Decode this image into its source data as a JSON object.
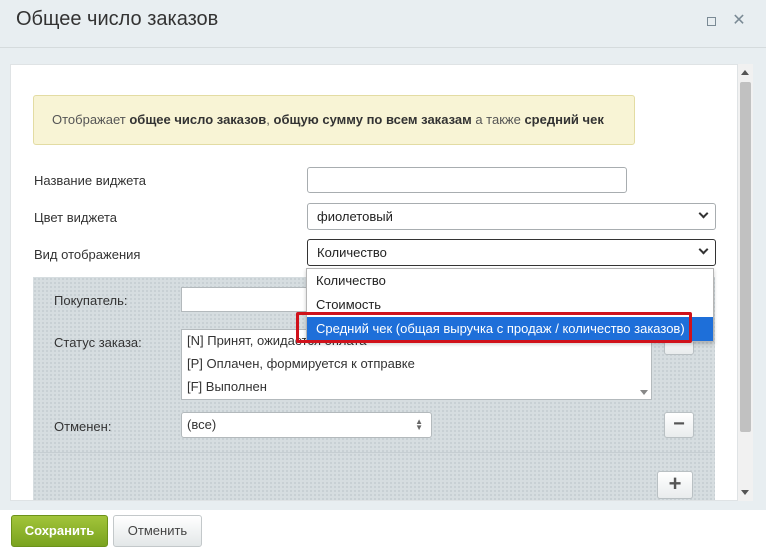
{
  "dialog": {
    "title": "Общее число заказов"
  },
  "info": {
    "prefix": "Отображает ",
    "b1": "общее число заказов",
    "sep1": ", ",
    "b2": "общую сумму по всем заказам",
    "mid": " а также ",
    "b3": "средний чек"
  },
  "form": {
    "name_label": "Название виджета",
    "name_value": "",
    "color_label": "Цвет виджета",
    "color_value": "фиолетовый",
    "view_label": "Вид отображения",
    "view_value": "Количество"
  },
  "filters": {
    "buyer_label": "Покупатель:",
    "buyer_value": "",
    "status_label": "Статус заказа:",
    "status_options": [
      "[N] Принят, ожидается оплата",
      "[P] Оплачен, формируется к отправке",
      "[F] Выполнен"
    ],
    "canceled_label": "Отменен:",
    "canceled_value": "(все)",
    "minus_glyph": "−",
    "plus_glyph": "+"
  },
  "dropdown": {
    "options": [
      "Количество",
      "Стоимость",
      "Средний чек (общая выручка с продаж / количество заказов)"
    ],
    "selected_index": 2
  },
  "footer": {
    "save_label": "Сохранить",
    "cancel_label": "Отменить"
  },
  "colors": {
    "accent_green": "#86af23",
    "selection_blue": "#1e6fd9",
    "highlight_red": "#d0121b"
  }
}
